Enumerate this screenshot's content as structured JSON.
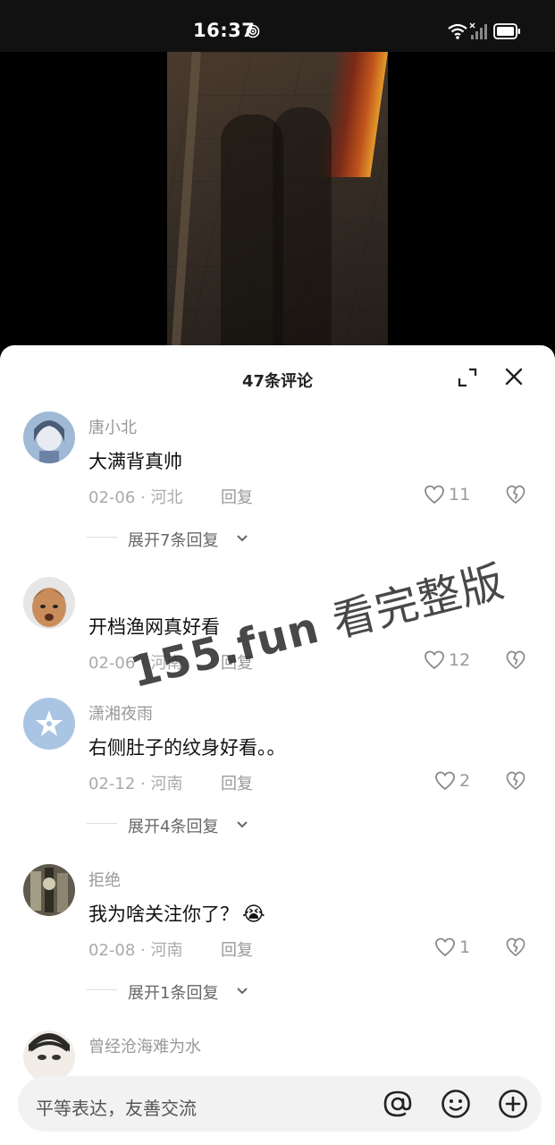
{
  "status_bar": {
    "time": "16:37"
  },
  "sheet": {
    "title": "47条评论"
  },
  "comments": [
    {
      "name": "唐小北",
      "text": "大满背真帅",
      "date": "02-06 · 河北",
      "reply": "回复",
      "likes": "11",
      "expand": "展开7条回复"
    },
    {
      "name": "",
      "text": "开档渔网真好看",
      "date": "02-06 · 河南",
      "reply": "回复",
      "likes": "12"
    },
    {
      "name": "潇湘夜雨",
      "text": "右侧肚子的纹身好看。。",
      "date": "02-12 · 河南",
      "reply": "回复",
      "likes": "2",
      "expand": "展开4条回复"
    },
    {
      "name": "拒绝",
      "text": "我为啥关注你了？",
      "emoji": "😭",
      "date": "02-08 · 河南",
      "reply": "回复",
      "likes": "1",
      "expand": "展开1条回复"
    },
    {
      "name": "曾经沧海难为水"
    }
  ],
  "watermark": {
    "brand": "155.fun",
    "text": "看完整版"
  },
  "input": {
    "placeholder": "平等表达，友善交流"
  },
  "icons": [
    "hotspot-icon",
    "wifi-icon",
    "signal-icon",
    "battery-icon",
    "expand-icon",
    "close-icon",
    "heart-icon",
    "broken-heart-icon",
    "chevron-down-icon",
    "at-icon",
    "smile-icon",
    "plus-icon"
  ]
}
